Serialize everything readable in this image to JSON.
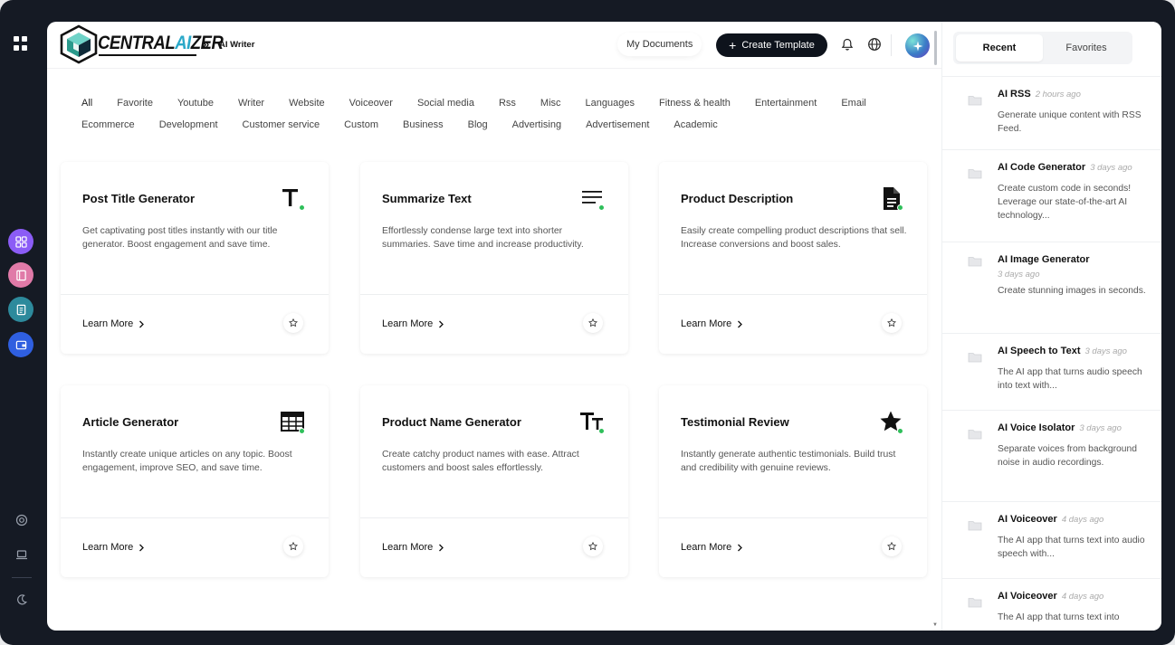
{
  "header": {
    "brand_prefix": "CENTRAL",
    "brand_highlight": "AI",
    "brand_suffix": "ZER",
    "breadcrumb_sep": "»",
    "breadcrumb": "AI Writer",
    "my_documents": "My Documents",
    "create_template": "Create Template"
  },
  "filters": {
    "row1": [
      "All",
      "Favorite",
      "Youtube",
      "Writer",
      "Website",
      "Voiceover",
      "Social media",
      "Rss",
      "Misc",
      "Languages",
      "Fitness & health",
      "Entertainment",
      "Email"
    ],
    "row2": [
      "Ecommerce",
      "Development",
      "Customer service",
      "Custom",
      "Business",
      "Blog",
      "Advertising",
      "Advertisement",
      "Academic"
    ]
  },
  "cards": [
    {
      "title": "Post Title Generator",
      "desc": "Get captivating post titles instantly with our title generator. Boost engagement and save time.",
      "icon": "text-t-icon",
      "learn": "Learn More"
    },
    {
      "title": "Summarize Text",
      "desc": "Effortlessly condense large text into shorter summaries. Save time and increase productivity.",
      "icon": "lines-icon",
      "learn": "Learn More"
    },
    {
      "title": "Product Description",
      "desc": "Easily create compelling product descriptions that sell. Increase conversions and boost sales.",
      "icon": "document-icon",
      "learn": "Learn More"
    },
    {
      "title": "Article Generator",
      "desc": "Instantly create unique articles on any topic. Boost engagement, improve SEO, and save time.",
      "icon": "article-icon",
      "learn": "Learn More"
    },
    {
      "title": "Product Name Generator",
      "desc": "Create catchy product names with ease. Attract customers and boost sales effortlessly.",
      "icon": "text-size-icon",
      "learn": "Learn More"
    },
    {
      "title": "Testimonial Review",
      "desc": "Instantly generate authentic testimonials. Build trust and credibility with genuine reviews.",
      "icon": "star-icon",
      "learn": "Learn More"
    }
  ],
  "side": {
    "tab_recent": "Recent",
    "tab_favorites": "Favorites",
    "items": [
      {
        "name": "AI RSS",
        "time": "2 hours ago",
        "desc": "Generate unique content with RSS Feed."
      },
      {
        "name": "AI Code Generator",
        "time": "3 days ago",
        "desc": "Create custom code in seconds! Leverage our state-of-the-art AI technology..."
      },
      {
        "name": "AI Image Generator",
        "time": "3 days ago",
        "desc": "Create stunning images in seconds."
      },
      {
        "name": "AI Speech to Text",
        "time": "3 days ago",
        "desc": "The AI app that turns audio speech into text with..."
      },
      {
        "name": "AI Voice Isolator",
        "time": "3 days ago",
        "desc": "Separate voices from background noise in audio recordings."
      },
      {
        "name": "AI Voiceover",
        "time": "4 days ago",
        "desc": "The AI app that turns text into audio speech with..."
      },
      {
        "name": "AI Voiceover",
        "time": "4 days ago",
        "desc": "The AI app that turns text into"
      }
    ]
  },
  "colors": {
    "accent_dark": "#0e131c",
    "brand_highlight": "#2aa8c8",
    "status_green": "#2fbf5a"
  }
}
